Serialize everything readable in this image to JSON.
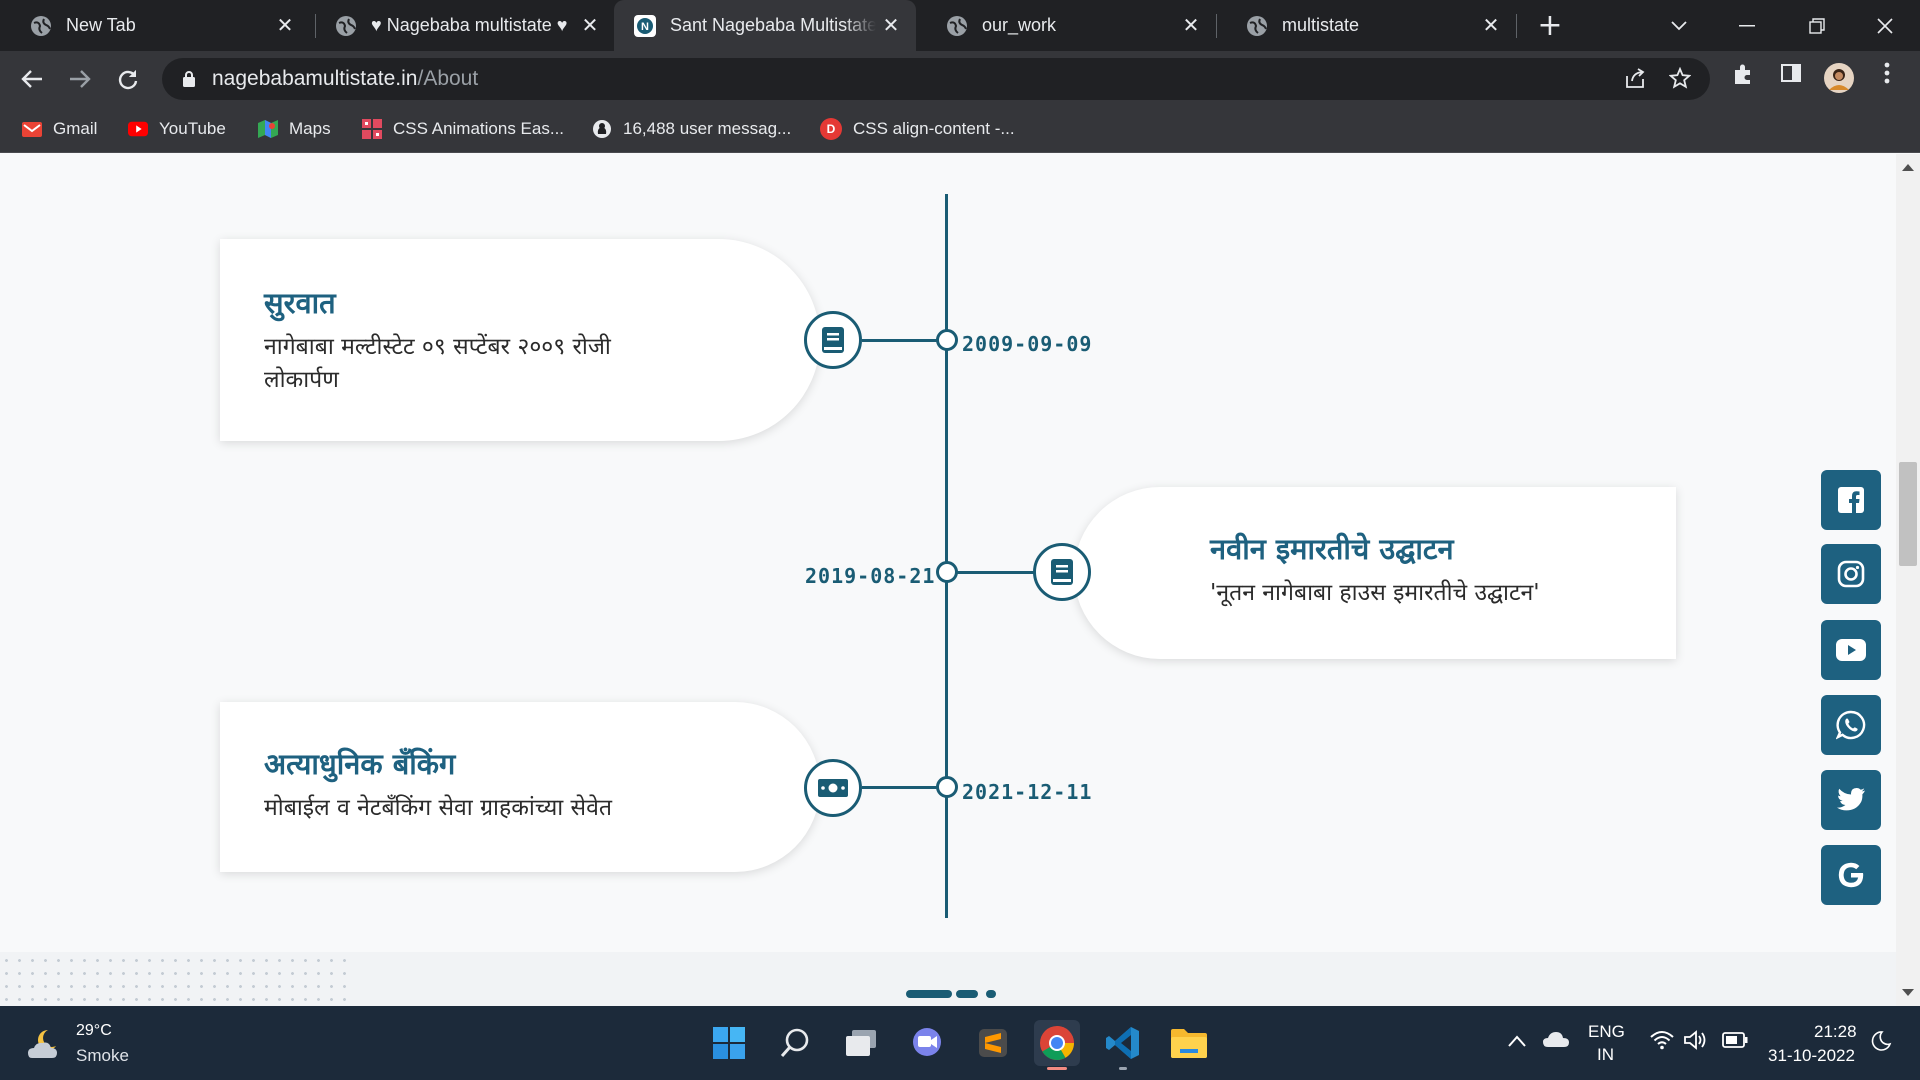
{
  "browser": {
    "tabs": [
      {
        "title": "New Tab",
        "favicon": "globe-icon",
        "active": false
      },
      {
        "title": "♥ Nagebaba multistate ♥",
        "favicon": "globe-icon",
        "active": false
      },
      {
        "title": "Sant Nagebaba Multistate",
        "favicon": "site-logo-icon",
        "active": true
      },
      {
        "title": "our_work",
        "favicon": "globe-icon",
        "active": false
      },
      {
        "title": "multistate",
        "favicon": "globe-icon",
        "active": false
      }
    ],
    "url_host": "nagebabamultistate.in",
    "url_path": "/About",
    "bookmarks": [
      {
        "label": "Gmail",
        "icon": "gmail-icon",
        "color": "#ea4335"
      },
      {
        "label": "YouTube",
        "icon": "youtube-icon",
        "color": "#ff0000"
      },
      {
        "label": "Maps",
        "icon": "maps-icon",
        "color": "#34a853"
      },
      {
        "label": "CSS Animations Eas...",
        "icon": "grid-icon",
        "color": "#e04a5f"
      },
      {
        "label": "16,488 user messag...",
        "icon": "github-icon",
        "color": "#202124"
      },
      {
        "label": "CSS align-content -...",
        "icon": "d-icon",
        "color": "#e53935"
      }
    ]
  },
  "timeline": {
    "accent_color": "#1a5c74",
    "heading_color": "#1e6180",
    "events": [
      {
        "title": "सुरवात",
        "text": "नागेबाबा मल्टीस्टेट ०९ सप्टेंबर २००९ रोजी लोकार्पण",
        "date": "2009-09-09",
        "side": "left",
        "icon": "book-icon"
      },
      {
        "title": "नवीन इमारतीचे उद्घाटन",
        "text": "'नूतन नागेबाबा हाउस इमारतीचे उद्घाटन'",
        "date": "2019-08-21",
        "side": "right",
        "icon": "book-icon"
      },
      {
        "title": "अत्याधुनिक बँकिंग",
        "text": "मोबाईल व नेटबँकिंग सेवा ग्राहकांच्या सेवेत",
        "date": "2021-12-11",
        "side": "left",
        "icon": "money-icon"
      }
    ]
  },
  "social_links": [
    "facebook-icon",
    "instagram-icon",
    "youtube-icon",
    "whatsapp-icon",
    "twitter-icon",
    "google-icon"
  ],
  "taskbar": {
    "weather_temp": "29°C",
    "weather_desc": "Smoke",
    "lang_primary": "ENG",
    "lang_secondary": "IN",
    "time": "21:28",
    "date": "31-10-2022"
  }
}
